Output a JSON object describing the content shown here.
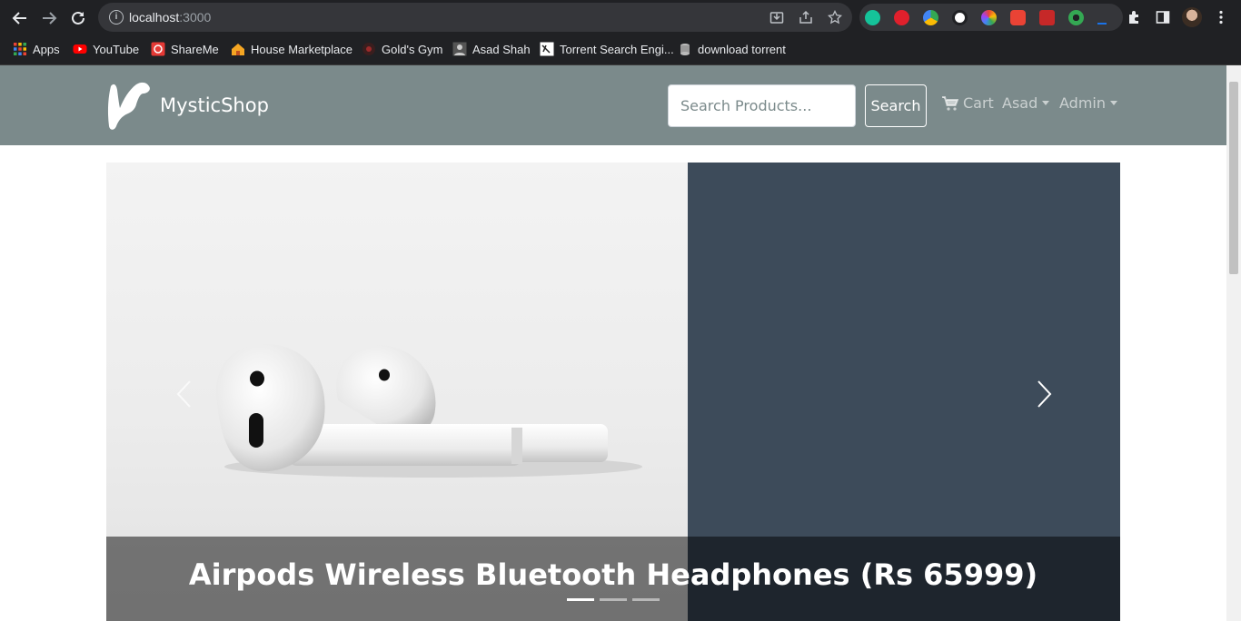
{
  "browser": {
    "url_host": "localhost",
    "url_port": ":3000",
    "bookmarks": [
      {
        "label": "Apps",
        "icon": "apps-grid-icon"
      },
      {
        "label": "YouTube",
        "icon": "youtube-icon"
      },
      {
        "label": "ShareMe",
        "icon": "shareme-icon"
      },
      {
        "label": "House Marketplace",
        "icon": "house-icon"
      },
      {
        "label": "Gold's Gym",
        "icon": "golds-gym-icon"
      },
      {
        "label": "Asad Shah",
        "icon": "asad-shah-icon"
      },
      {
        "label": "Torrent Search Engi...",
        "icon": "torrent-search-icon"
      },
      {
        "label": "download torrent",
        "icon": "download-torrent-icon"
      }
    ]
  },
  "navbar": {
    "brand": "MysticShop",
    "search_placeholder": "Search Products...",
    "search_button": "Search",
    "cart": "Cart",
    "user_menu": "Asad",
    "admin_menu": "Admin"
  },
  "carousel": {
    "caption": "Airpods Wireless Bluetooth Headphones (Rs 65999)",
    "slide_count": 3,
    "active_slide": 1
  },
  "colors": {
    "navbar_bg": "#7b8a8b",
    "slide_bg": "#3d4b5a",
    "chrome_bg": "#202124"
  }
}
